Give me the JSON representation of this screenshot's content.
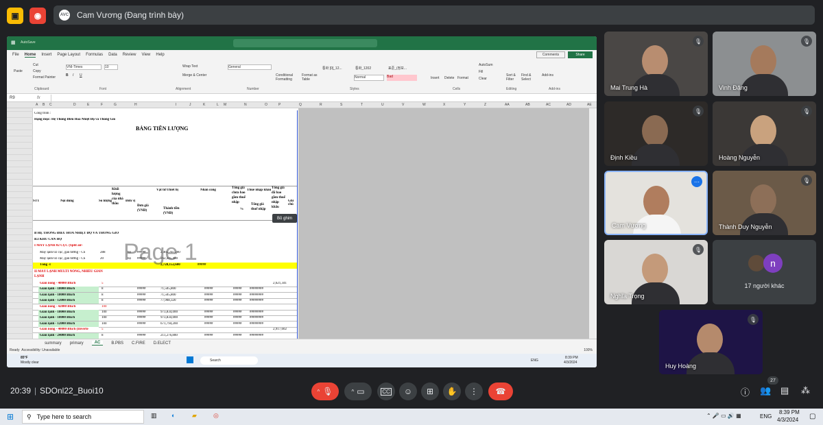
{
  "meet": {
    "presenter_label": "Cam Vương (Đang trình bày)",
    "presenter_avatar_text": "AVC",
    "clock": "20:39",
    "meeting_code": "SDOnl22_Buoi10",
    "participant_count": "27",
    "others_label": "17 người khác",
    "others_initial": "n",
    "colors": {
      "accent_red": "#ea4335",
      "present_yellow": "#fbbc04",
      "bg": "#202124"
    }
  },
  "participants": [
    {
      "name": "Mai Trung Hà",
      "muted": true
    },
    {
      "name": "Vinh Đặng",
      "muted": true
    },
    {
      "name": "Định Kiều",
      "muted": true
    },
    {
      "name": "Hoàng Nguyễn",
      "muted": true
    },
    {
      "name": "Cam Vương",
      "muted": false
    },
    {
      "name": "Thành Duy Nguyễn",
      "muted": true
    },
    {
      "name": "Nghĩa Trọng",
      "muted": true
    },
    {
      "name": "Huy Hoàng",
      "muted": true
    }
  ],
  "excel": {
    "menu": [
      "File",
      "Home",
      "Insert",
      "Page Layout",
      "Formulas",
      "Data",
      "Review",
      "View",
      "Help"
    ],
    "ribbon_groups": [
      "Clipboard",
      "Font",
      "Alignment",
      "Number",
      "Styles",
      "Cells",
      "Editing",
      "Add-ins"
    ],
    "ribbon_buttons": {
      "cut": "Cut",
      "copy": "Copy",
      "format_painter": "Format Painter",
      "paste": "Paste",
      "font": "VNI-Times",
      "size": "10",
      "wrap": "Wrap Text",
      "merge": "Merge & Center",
      "number_format": "General",
      "cond_fmt": "Conditional Formatting",
      "format_table": "Format as Table",
      "style1": "통화 [0]_12...",
      "style2": "통화_1202",
      "style3": "표준_(정보...",
      "style_normal": "Normal",
      "style_bad": "Bad",
      "insert": "Insert",
      "delete": "Delete",
      "format": "Format",
      "autosum": "AutoSum",
      "fill": "Fill",
      "clear": "Clear",
      "sort": "Sort & Filter",
      "find": "Find & Select",
      "addins": "Add-ins",
      "comments": "Comments",
      "share": "Share",
      "autosave": "AutoSave"
    },
    "name_box": "R9",
    "fx": "fx",
    "columns": [
      "A",
      "B",
      "C",
      "D",
      "E",
      "F",
      "G",
      "H",
      "I",
      "J",
      "K",
      "L",
      "M",
      "N",
      "O",
      "P",
      "Q",
      "R",
      "S",
      "T",
      "U",
      "V",
      "W",
      "X",
      "Y",
      "Z",
      "AA",
      "AB",
      "AC",
      "AD",
      "AE"
    ],
    "sheet_tabs": [
      "summary",
      "primary",
      "AC",
      "B.PBS",
      "C.FIRE",
      "D.ELECT"
    ],
    "active_tab": "AC",
    "status_ready": "Ready",
    "status_access": "Accessibility: Unavailable",
    "zoom": "100%",
    "watermark": "Page 1",
    "tooltip": "Bỏ ghim",
    "doc": {
      "project": "Công trình :",
      "item": "Hạng mục: Hệ Thống Điều Hoà Nhiệt Độ và Thông Gió",
      "title": "BẢNG TIỀN LƯỢNG",
      "h_stt": "STT",
      "h_content": "Nội dung",
      "h_qty": "Số lượng",
      "h_weight": "Khối lượng của nhà thầu",
      "h_unit": "Đơn vị",
      "h_materials": "Vật tư/Thiết bị",
      "h_labor": "Nhân công",
      "h_total_pre": "Tổng giá chưa bao gồm thuế nhập",
      "h_import_tax": "Thuế nhập khẩu",
      "h_total_post": "Tổng giá đã bao gồm thuế nhập khẩu",
      "h_note": "Ghi chú",
      "h_unit_price": "Đơn giá (VNĐ)",
      "h_amount": "Thành tiền (VNĐ)",
      "h_percent": "%",
      "h_total_tax": "Tổng giá thuế nhập",
      "sec_b": "B  HỆ THỐNG ĐIỀU HOÀ NHIỆT ĐỘ VÀ THÔNG GIÓ",
      "sec_b1": "B.I  KHU CĂN HỘ",
      "sec_i": "I  MÁY LẠNH 02 CỤC (Split air-",
      "row1": "Máy lạnh 02 cục, gắn tường - CS",
      "row1_qty": "288",
      "row1_unit": "bộ",
      "row1_amt": "2,465,707,200",
      "row2": "Máy lạnh 02 cục, gắn tường - CS",
      "row2_qty": "20",
      "row2_unit": "bộ",
      "row2_amt": "262,445,400",
      "subtotal": "Tổng -I",
      "subtotal_amt": "2,728,152,600",
      "sec_ii": "II  MÁY LẠNH MULTI NÓNG, NHIỀU GIÀN LẠNH",
      "sub_rows": [
        {
          "name": "Giàn nóng - 40000 Btu/h",
          "qty": "5",
          "amt": "",
          "total": "2,621,341",
          "red": true
        },
        {
          "name": "Giàn lạnh - 18000 Btu/h",
          "qty": "8",
          "amt": "71,505,800",
          "total": "",
          "red": false
        },
        {
          "name": "Giàn lạnh - 18000 Btu/h",
          "qty": "8",
          "amt": "71,505,800",
          "total": "",
          "red": false
        },
        {
          "name": "Giàn lạnh - 12000 Btu/h",
          "qty": "8",
          "amt": "77,908,320",
          "total": "",
          "red": false
        },
        {
          "name": "Giàn nóng - 42000 Btu/h",
          "qty": "100",
          "amt": "",
          "total": "",
          "red": true
        },
        {
          "name": "Giàn lạnh - 18000 Btu/h",
          "qty": "100",
          "amt": "973,834,000",
          "total": "",
          "red": false
        },
        {
          "name": "Giàn lạnh - 18000 Btu/h",
          "qty": "100",
          "amt": "973,834,000",
          "total": "",
          "red": false
        },
        {
          "name": "Giàn lạnh - 12000 Btu/h",
          "qty": "100",
          "amt": "671,794,200",
          "total": "",
          "red": false
        },
        {
          "name": "Giàn nóng - 40000 Btu/h (Inverte",
          "qty": "5",
          "amt": "",
          "total": "2,917,602",
          "red": true
        },
        {
          "name": "Giàn lạnh - 24000 Btu/h",
          "qty": "8",
          "amt": "211,276,800",
          "total": "",
          "red": false
        },
        {
          "name": "Giàn lạnh - 18000 Btu/h",
          "qty": "8",
          "amt": "211,276,800",
          "total": "",
          "red": false
        },
        {
          "name": "Giàn lạnh - 18000 Btu/h",
          "qty": "8",
          "amt": "211,276,800",
          "total": "",
          "red": false
        },
        {
          "name": "Giàn nóng - 40000 Btu/h (Inverte",
          "qty": "5",
          "amt": "",
          "total": "2,912,602",
          "red": true
        },
        {
          "name": "Giàn lạnh - 24000 Btu/h",
          "qty": "8",
          "amt": "211,276,800",
          "total": "",
          "red": false
        }
      ],
      "hash": "#####",
      "hash_long": "########"
    },
    "win_taskbar": {
      "weather_temp": "85°F",
      "weather_desc": "Mostly clear",
      "search": "Search",
      "lang": "ENG",
      "time": "8:39 PM",
      "date": "4/3/2024"
    }
  },
  "os": {
    "search_placeholder": "Type here to search",
    "lang": "ENG",
    "time": "8:39 PM",
    "date": "4/3/2024"
  }
}
